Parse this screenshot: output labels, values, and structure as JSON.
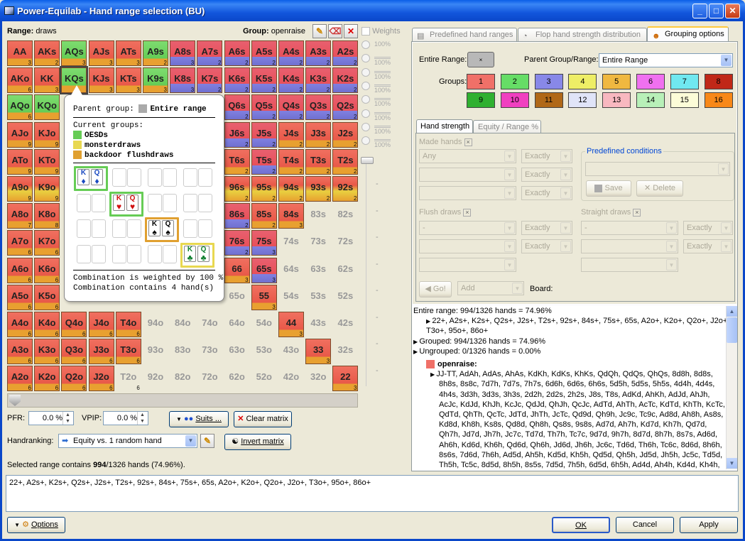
{
  "window": {
    "title": "Power-Equilab - Hand range selection (BU)",
    "min": "_",
    "max": "□",
    "close": "✕"
  },
  "header": {
    "range_label": "Range:",
    "range_value": "draws",
    "group_label": "Group:",
    "group_value": "openraise",
    "weights_label": "Weights"
  },
  "matrix": [
    [
      "AA",
      "AKs",
      "AQs",
      "AJs",
      "ATs",
      "A9s",
      "A8s",
      "A7s",
      "A6s",
      "A5s",
      "A4s",
      "A3s",
      "A2s"
    ],
    [
      "AKo",
      "KK",
      "KQs",
      "KJs",
      "KTs",
      "K9s",
      "K8s",
      "K7s",
      "K6s",
      "K5s",
      "K4s",
      "K3s",
      "K2s"
    ],
    [
      "AQo",
      "KQo",
      "",
      "",
      "",
      "",
      "",
      "",
      "Q6s",
      "Q5s",
      "Q4s",
      "Q3s",
      "Q2s"
    ],
    [
      "AJo",
      "KJo",
      "",
      "",
      "",
      "",
      "",
      "",
      "J6s",
      "J5s",
      "J4s",
      "J3s",
      "J2s"
    ],
    [
      "ATo",
      "KTo",
      "",
      "",
      "",
      "",
      "",
      "",
      "T6s",
      "T5s",
      "T4s",
      "T3s",
      "T2s"
    ],
    [
      "A9o",
      "K9o",
      "",
      "",
      "",
      "",
      "",
      "",
      "96s",
      "95s",
      "94s",
      "93s",
      "92s"
    ],
    [
      "A8o",
      "K8o",
      "",
      "",
      "",
      "",
      "",
      "",
      "86s",
      "85s",
      "84s",
      "83s",
      "82s"
    ],
    [
      "A7o",
      "K7o",
      "",
      "",
      "",
      "",
      "",
      "",
      "76s",
      "75s",
      "74s",
      "73s",
      "72s"
    ],
    [
      "A6o",
      "K6o",
      "",
      "",
      "",
      "",
      "",
      "",
      "66",
      "65s",
      "64s",
      "63s",
      "62s"
    ],
    [
      "A5o",
      "K5o",
      "",
      "",
      "",
      "",
      "",
      "",
      "65o",
      "55",
      "54s",
      "53s",
      "52s"
    ],
    [
      "A4o",
      "K4o",
      "Q4o",
      "J4o",
      "T4o",
      "94o",
      "84o",
      "74o",
      "64o",
      "54o",
      "44",
      "43s",
      "42s"
    ],
    [
      "A3o",
      "K3o",
      "Q3o",
      "J3o",
      "T3o",
      "93o",
      "83o",
      "73o",
      "63o",
      "53o",
      "43o",
      "33",
      "32s"
    ],
    [
      "A2o",
      "K2o",
      "Q2o",
      "J2o",
      "T2o",
      "92o",
      "82o",
      "72o",
      "62o",
      "52o",
      "42o",
      "32o",
      "22"
    ]
  ],
  "matrix_counts": [
    [
      "3",
      "2",
      "3",
      "3",
      "3",
      "2",
      "3",
      "2",
      "2",
      "2",
      "2",
      "2",
      "2"
    ],
    [
      "6",
      "3",
      "",
      "3",
      "3",
      "3",
      "3",
      "2",
      "2",
      "2",
      "2",
      "2",
      "2"
    ],
    [
      "6",
      "",
      "",
      "",
      "",
      "",
      "",
      "",
      "2",
      "2",
      "2",
      "2",
      "2"
    ],
    [
      "9",
      "9",
      "",
      "",
      "",
      "",
      "",
      "",
      "2",
      "2",
      "2",
      "2",
      "2"
    ],
    [
      "9",
      "9",
      "",
      "",
      "",
      "",
      "",
      "",
      "2",
      "2",
      "2",
      "2",
      "2"
    ],
    [
      "9",
      "9",
      "",
      "",
      "",
      "",
      "",
      "",
      "2",
      "2",
      "2",
      "2",
      "2"
    ],
    [
      "7",
      "8",
      "",
      "",
      "",
      "",
      "",
      "",
      "2",
      "2",
      "3",
      "",
      ""
    ],
    [
      "6",
      "6",
      "",
      "",
      "",
      "",
      "",
      "",
      "2",
      "3",
      "",
      "",
      ""
    ],
    [
      "6",
      "6",
      "",
      "",
      "",
      "",
      "",
      "",
      "3",
      "3",
      "",
      "",
      ""
    ],
    [
      "6",
      "6",
      "",
      "",
      "",
      "",
      "",
      "",
      "",
      "3",
      "",
      "",
      ""
    ],
    [
      "6",
      "6",
      "6",
      "6",
      "6",
      "",
      "",
      "",
      "",
      "",
      "3",
      "",
      ""
    ],
    [
      "6",
      "6",
      "6",
      "6",
      "6",
      "",
      "",
      "",
      "",
      "",
      "",
      "3",
      ""
    ],
    [
      "6",
      "6",
      "6",
      "6",
      "6",
      "",
      "",
      "",
      "",
      "",
      "",
      "",
      "3"
    ]
  ],
  "weights": [
    "100%",
    "100%",
    "100%",
    "100%",
    "100%",
    "100%",
    "100%",
    "100%"
  ],
  "tooltip": {
    "parent_label": "Parent group:",
    "parent_value": "Entire range",
    "current_label": "Current groups:",
    "groups": [
      {
        "name": "OESDs",
        "color": "#66cc55"
      },
      {
        "name": "monsterdraws",
        "color": "#e8d850"
      },
      {
        "name": "backdoor flushdraws",
        "color": "#e0a030"
      }
    ],
    "weighted": "Combination is weighted by 100 %",
    "contains": "Combination contains 4 hand(s)",
    "cards": [
      [
        "K",
        "♦",
        "Q",
        "♦"
      ],
      [
        "K",
        "♥",
        "Q",
        "♥"
      ],
      [
        "K",
        "♠",
        "Q",
        "♠"
      ],
      [
        "K",
        "♣",
        "Q",
        "♣"
      ]
    ]
  },
  "bottom": {
    "pfr_label": "PFR:",
    "pfr_value": "0.0 %",
    "vpip_label": "VPIP:",
    "vpip_value": "0.0 %",
    "suits_btn": "Suits ...",
    "clear_btn": "Clear matrix",
    "handranking_label": "Handranking:",
    "handranking_value": "Equity vs. 1 random hand",
    "invert_btn": "Invert matrix",
    "selected_prefix": "Selected range contains ",
    "selected_count": "994",
    "selected_suffix": "/1326 hands (74.96%).",
    "range_text": "22+, A2s+, K2s+, Q2s+, J2s+, T2s+, 92s+, 84s+, 75s+, 65s, A2o+, K2o+, Q2o+, J2o+, T3o+, 95o+, 86o+",
    "options_btn": "Options",
    "ok_btn": "OK",
    "cancel_btn": "Cancel",
    "apply_btn": "Apply"
  },
  "tabs": [
    "Predefined hand ranges",
    "Flop hand strength distribution",
    "Grouping options"
  ],
  "grouping": {
    "entire_label": "Entire Range:",
    "parent_label": "Parent Group/Range:",
    "parent_value": "Entire Range",
    "groups_label": "Groups:",
    "groups": [
      {
        "n": "1",
        "c": "#f07068"
      },
      {
        "n": "2",
        "c": "#66dd66"
      },
      {
        "n": "3",
        "c": "#8888e8"
      },
      {
        "n": "4",
        "c": "#eeee66"
      },
      {
        "n": "5",
        "c": "#f0b840"
      },
      {
        "n": "6",
        "c": "#f070f0"
      },
      {
        "n": "7",
        "c": "#70e8f0"
      },
      {
        "n": "8",
        "c": "#c02818"
      },
      {
        "n": "9",
        "c": "#30b030"
      },
      {
        "n": "10",
        "c": "#f040c0"
      },
      {
        "n": "11",
        "c": "#b06818"
      },
      {
        "n": "12",
        "c": "#e0e4f8"
      },
      {
        "n": "13",
        "c": "#f8b8c0"
      },
      {
        "n": "14",
        "c": "#b8f0b8"
      },
      {
        "n": "15",
        "c": "#fcfcd8"
      },
      {
        "n": "16",
        "c": "#f88818"
      }
    ]
  },
  "subtabs": [
    "Hand strength",
    "Equity / Range %"
  ],
  "hs": {
    "made_label": "Made hands",
    "any": "Any",
    "exactly": "Exactly",
    "predef_label": "Predefined conditions",
    "save": "Save",
    "delete": "Delete",
    "flush_label": "Flush draws",
    "straight_label": "Straight draws",
    "dash": "-",
    "go": "Go!",
    "add": "Add",
    "board_label": "Board:"
  },
  "rangeinfo": [
    "Entire range: 994/1326 hands = 74.96%",
    "22+, A2s+, K2s+, Q2s+, J2s+, T2s+, 92s+, 84s+, 75s+, 65s, A2o+, K2o+, Q2o+, J2o+,",
    "T3o+, 95o+, 86o+",
    "Grouped: 994/1326 hands = 74.96%",
    "Ungrouped: 0/1326 hands = 0.00%",
    "openraise:",
    "JJ-TT, AdAh, AdAs, AhAs, KdKh, KdKs, KhKs, QdQh, QdQs, QhQs, 8d8h, 8d8s,",
    "8h8s, 8s8c, 7d7h, 7d7s, 7h7s, 6d6h, 6d6s, 6h6s, 5d5h, 5d5s, 5h5s, 4d4h, 4d4s,",
    "4h4s, 3d3h, 3d3s, 3h3s, 2d2h, 2d2s, 2h2s, J8s, T8s, AdKd, AhKh, AdJd, AhJh,",
    "AcJc, KdJd, KhJh, KcJc, QdJd, QhJh, QcJc, AdTd, AhTh, AcTc, KdTd, KhTh, KcTc,",
    "QdTd, QhTh, QcTc, JdTd, JhTh, JcTc, Qd9d, Qh9h, Jc9c, Tc9c, Ad8d, Ah8h, As8s,",
    "Kd8d, Kh8h, Ks8s, Qd8d, Qh8h, Qs8s, 9s8s, Ad7d, Ah7h, Kd7d, Kh7h, Qd7d,",
    "Qh7h, Jd7d, Jh7h, Jc7c, Td7d, Th7h, Tc7c, 9d7d, 9h7h, 8d7d, 8h7h, 8s7s, Ad6d,",
    "Ah6h, Kd6d, Kh6h, Qd6d, Qh6h, Jd6d, Jh6h, Jc6c, Td6d, Th6h, Tc6c, 8d6d, 8h6h,",
    "8s6s, 7d6d, 7h6h, Ad5d, Ah5h, Kd5d, Kh5h, Qd5d, Qh5h, Jd5d, Jh5h, Jc5c, Td5d,",
    "Th5h, Tc5c, 8d5d, 8h5h, 8s5s, 7d5d, 7h5h, 6d5d, 6h5h, Ad4d, Ah4h, Kd4d, Kh4h,"
  ]
}
